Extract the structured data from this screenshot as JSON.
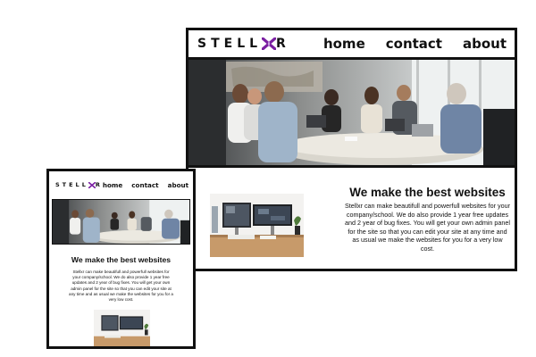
{
  "brand": {
    "name_left": "STELL",
    "name_x": "X",
    "name_right": "R",
    "accent": "#7a1fa2"
  },
  "nav": {
    "home": "home",
    "contact": "contact",
    "about": "about"
  },
  "main": {
    "headline": "We make the best websites",
    "paragraph": "Stellxr can make beautifull and powerfull websites for your company/school. We do also provide 1 year free updates and 2 year of bug fixes. You will get your own admin panel for the site so that you can edit your site at any time and as usual we make the websites for you for a very low cost."
  },
  "images": {
    "hero": "meeting-room-photo",
    "thumb": "workstation-photo"
  }
}
